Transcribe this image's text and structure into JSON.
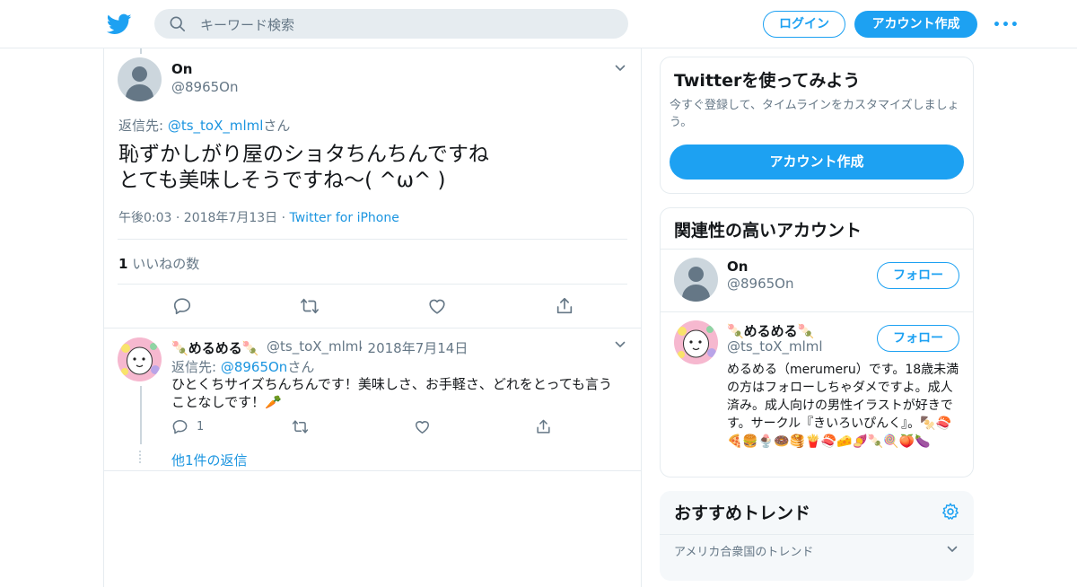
{
  "topbar": {
    "search_placeholder": "キーワード検索",
    "login_label": "ログイン",
    "signup_label": "アカウント作成",
    "more_label": "•••"
  },
  "tweet": {
    "name": "On",
    "handle": "@8965On",
    "reply_prefix": "返信先: ",
    "reply_handle": "@ts_toX_mlml",
    "reply_suffix": "さん",
    "text_line1": "恥ずかしがり屋のショタちんちんですね",
    "text_line2": "とても美味しそうですね〜( ^ω^ )",
    "time": "午後0:03 · 2018年7月13日 · ",
    "client": "Twitter for iPhone",
    "like_count": "1",
    "like_label": " いいねの数"
  },
  "reply": {
    "name": "めるめる",
    "name_emoji": "🍡",
    "handle": "@ts_toX_mlml",
    "date": "· 2018年7月14日",
    "reply_prefix": "返信先: ",
    "reply_handle": "@8965On",
    "reply_suffix": "さん",
    "text": "ひとくちサイズちんちんです！美味しさ、お手軽さ、どれをとっても言うことなしです！🥕",
    "reply_count": "1",
    "more_replies": "他1件の返信"
  },
  "sidebar": {
    "try_title": "Twitterを使ってみよう",
    "try_sub": "今すぐ登録して、タイムラインをカスタマイズしましょう。",
    "try_button": "アカウント作成",
    "related_title": "関連性の高いアカウント",
    "accounts": [
      {
        "name": "On",
        "handle": "@8965On",
        "follow": "フォロー"
      },
      {
        "name": "🍡めるめる🍡",
        "handle": "@ts_toX_mlml",
        "follow": "フォロー",
        "bio": "めるめる（merumeru）です。18歳未満の方はフォローしちゃダメですよ。成人済み。成人向けの男性イラストが好きです。サークル『きいろいぴんく』。🍢🍣🍕🍔🍨🍩🥞🍟🍣🧀🍠🍡🍭🍑🍆"
      }
    ],
    "trends_title": "おすすめトレンド",
    "trends_region": "アメリカ合衆国のトレンド"
  },
  "colors": {
    "accent": "#1da1f2",
    "link": "#1b95e0",
    "muted": "#657786",
    "border": "#e6ecf0"
  }
}
